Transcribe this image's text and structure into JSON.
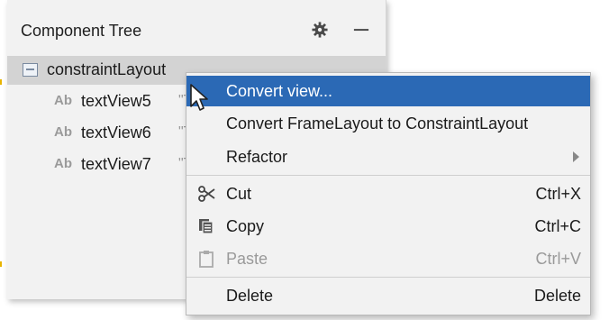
{
  "panel": {
    "title": "Component Tree"
  },
  "tree": {
    "root": {
      "label": "constraintLayout"
    },
    "items": [
      {
        "badge": "Ab",
        "label": "textView5",
        "extra": "\"T"
      },
      {
        "badge": "Ab",
        "label": "textView6",
        "extra": "\"T"
      },
      {
        "badge": "Ab",
        "label": "textView7",
        "extra": "\"T"
      }
    ]
  },
  "menu": {
    "items": [
      {
        "label": "Convert view...",
        "shortcut": ""
      },
      {
        "label": "Convert FrameLayout to ConstraintLayout",
        "shortcut": ""
      },
      {
        "label": "Refactor",
        "shortcut": ""
      },
      {
        "label": "Cut",
        "shortcut": "Ctrl+X"
      },
      {
        "label": "Copy",
        "shortcut": "Ctrl+C"
      },
      {
        "label": "Paste",
        "shortcut": "Ctrl+V"
      },
      {
        "label": "Delete",
        "shortcut": "Delete"
      }
    ]
  },
  "colors": {
    "selection": "#2b69b5",
    "panel_bg": "#f2f2f2",
    "tree_root_bg": "#d3d3d3"
  },
  "icons": [
    "gear-icon",
    "minimize-icon",
    "layout-icon",
    "scissors-icon",
    "copy-icon",
    "paste-icon",
    "cursor-icon"
  ]
}
